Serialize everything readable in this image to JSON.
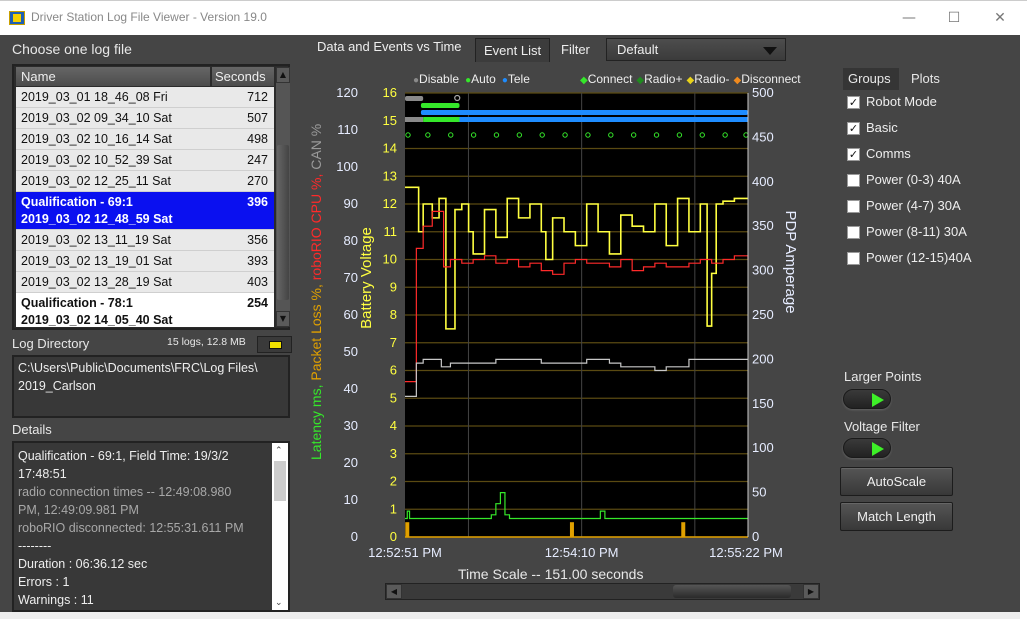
{
  "window": {
    "title": "Driver Station Log File Viewer - Version 19.0",
    "controls": [
      "minimize",
      "maximize",
      "close"
    ]
  },
  "file_list": {
    "label": "Choose one log file",
    "columns": [
      "Name",
      "Seconds"
    ],
    "rows": [
      {
        "name": "2019_03_01 18_46_08 Fri",
        "seconds": "712"
      },
      {
        "name": "2019_03_02 09_34_10 Sat",
        "seconds": "507"
      },
      {
        "name": "2019_03_02 10_16_14 Sat",
        "seconds": "498"
      },
      {
        "name": "2019_03_02 10_52_39 Sat",
        "seconds": "247"
      },
      {
        "name": "2019_03_02 12_25_11 Sat",
        "seconds": "270"
      },
      {
        "name": "Qualification - 69:1",
        "name2": "2019_03_02 12_48_59 Sat",
        "seconds": "396",
        "selected": true
      },
      {
        "name": "2019_03_02 13_11_19 Sat",
        "seconds": "356"
      },
      {
        "name": "2019_03_02 13_19_01 Sat",
        "seconds": "393"
      },
      {
        "name": "2019_03_02 13_28_19 Sat",
        "seconds": "403"
      },
      {
        "name": "Qualification - 78:1",
        "name2": "2019_03_02 14_05_40 Sat",
        "seconds": "254"
      }
    ]
  },
  "log_directory": {
    "label": "Log Directory",
    "summary": "15 logs, 12.8 MB",
    "path_line1": "C:\\Users\\Public\\Documents\\FRC\\Log Files\\",
    "path_line2": "2019_Carlson"
  },
  "details": {
    "label": "Details",
    "lines": [
      {
        "text": " Qualification - 69:1, Field Time: 19/3/2",
        "dim": false
      },
      {
        "text": "17:48:51",
        "dim": false
      },
      {
        "text": "radio connection times --  12:49:08.980",
        "dim": true
      },
      {
        "text": "PM,   12:49:09.981 PM",
        "dim": true
      },
      {
        "text": "roboRIO disconnected:  12:55:31.611 PM",
        "dim": true
      },
      {
        "text": "--------",
        "dim": false
      },
      {
        "text": "Duration : 06:36.12 sec",
        "dim": false
      },
      {
        "text": "Errors : 1",
        "dim": false
      },
      {
        "text": "Warnings : 11",
        "dim": false
      }
    ]
  },
  "tabs": {
    "active": "Data and Events vs Time",
    "event_list": "Event List",
    "filter_label": "Filter",
    "filter_value": "Default"
  },
  "legend": {
    "modes": [
      {
        "label": "Disable",
        "color": "#8a8a8a"
      },
      {
        "label": "Auto",
        "color": "#35e82a"
      },
      {
        "label": "Tele",
        "color": "#1e8cff"
      }
    ],
    "events": [
      {
        "label": "Connect",
        "color": "#35e82a"
      },
      {
        "label": "Radio+",
        "color": "#1f8a1f"
      },
      {
        "label": "Radio-",
        "color": "#e8d21a"
      },
      {
        "label": "Disconnect",
        "color": "#f08a1e"
      }
    ]
  },
  "side_panel": {
    "tabs": [
      "Groups",
      "Plots"
    ],
    "groups": [
      {
        "label": "Robot Mode",
        "checked": true
      },
      {
        "label": "Basic",
        "checked": true
      },
      {
        "label": "Comms",
        "checked": true
      },
      {
        "label": "Power (0-3) 40A",
        "checked": false
      },
      {
        "label": "Power (4-7) 30A",
        "checked": false
      },
      {
        "label": "Power (8-11) 30A",
        "checked": false
      },
      {
        "label": "Power (12-15)40A",
        "checked": false
      }
    ],
    "larger_points_label": "Larger Points",
    "larger_points_on": true,
    "voltage_filter_label": "Voltage Filter",
    "voltage_filter_on": true,
    "autoscale_label": "AutoScale",
    "match_length_label": "Match Length"
  },
  "time_scale": {
    "label": "Time Scale -- 151.00 seconds",
    "scroll_position": 0.78
  },
  "chart_data": {
    "type": "line",
    "title": "",
    "xlabel": "Time",
    "x_ticks": [
      "12:52:51 PM",
      "12:54:10 PM",
      "12:55:22 PM"
    ],
    "x_range_seconds": 151,
    "axes": {
      "left_outer": {
        "label_parts": [
          {
            "text": "Latency ms, ",
            "color": "#35e82a"
          },
          {
            "text": "Packet Loss %, ",
            "color": "#e0a000"
          },
          {
            "text": "roboRIO CPU %, ",
            "color": "#ff2a2a"
          },
          {
            "text": "CAN %",
            "color": "#9a9a9a"
          }
        ],
        "range": [
          0,
          120
        ],
        "ticks": [
          0,
          10,
          20,
          30,
          40,
          50,
          60,
          70,
          80,
          90,
          100,
          110,
          120
        ]
      },
      "left_inner": {
        "label": "Battery Voltage",
        "color": "#ffff40",
        "range": [
          0,
          16
        ],
        "ticks": [
          0,
          1,
          2,
          3,
          4,
          5,
          6,
          7,
          8,
          9,
          10,
          11,
          12,
          13,
          14,
          15,
          16
        ]
      },
      "right": {
        "label": "PDP Amperage",
        "color": "#dfe8ff",
        "range": [
          0,
          500
        ],
        "ticks": [
          0,
          50,
          100,
          150,
          200,
          250,
          300,
          350,
          400,
          450,
          500
        ]
      }
    },
    "grid": true,
    "legend_position": "top",
    "series": [
      {
        "name": "Battery Voltage",
        "axis": "left_inner",
        "color": "#ffff40",
        "x": [
          0,
          5,
          6,
          8,
          12,
          15,
          18,
          22,
          25,
          28,
          30,
          35,
          40,
          45,
          50,
          55,
          60,
          62,
          65,
          70,
          75,
          80,
          85,
          90,
          95,
          100,
          105,
          110,
          115,
          120,
          125,
          130,
          133,
          135,
          137,
          140,
          145,
          151
        ],
        "y": [
          12.6,
          12.6,
          11.0,
          12.0,
          11.5,
          12.2,
          7.5,
          11.8,
          12.0,
          11.0,
          10.2,
          11.8,
          10.8,
          12.2,
          11.5,
          12.0,
          11.0,
          10.0,
          11.5,
          11.0,
          10.5,
          12.0,
          11.0,
          10.2,
          11.6,
          11.2,
          11.0,
          12.0,
          10.5,
          12.2,
          11.0,
          12.0,
          7.6,
          9.5,
          12.0,
          12.1,
          12.2,
          12.2
        ]
      },
      {
        "name": "roboRIO CPU %",
        "axis": "left_outer",
        "color": "#ff2a2a",
        "x": [
          0,
          4,
          5,
          8,
          12,
          15,
          17,
          20,
          25,
          30,
          35,
          40,
          45,
          50,
          55,
          60,
          65,
          70,
          75,
          80,
          85,
          90,
          95,
          100,
          105,
          110,
          115,
          120,
          125,
          130,
          135,
          140,
          145,
          151
        ],
        "y": [
          42,
          42,
          78,
          84,
          88,
          88,
          73,
          75,
          74,
          75,
          76,
          74,
          75,
          73,
          74,
          72,
          71,
          74,
          75,
          74,
          74,
          73,
          75,
          72,
          73,
          74,
          73,
          73,
          74,
          75,
          74,
          75,
          76,
          75
        ]
      },
      {
        "name": "CAN %",
        "axis": "left_outer",
        "color": "#c8c8c8",
        "x": [
          0,
          4,
          5,
          8,
          15,
          16,
          20,
          30,
          40,
          50,
          60,
          70,
          80,
          90,
          95,
          100,
          105,
          110,
          115,
          120,
          125,
          130,
          135,
          140,
          145,
          151
        ],
        "y": [
          38,
          38,
          47,
          48,
          48,
          46,
          47,
          47,
          48,
          48,
          47,
          47,
          48,
          47,
          46,
          46,
          46,
          45,
          46,
          46,
          48,
          48,
          48,
          48,
          48,
          48
        ]
      },
      {
        "name": "Latency ms",
        "axis": "left_outer",
        "color": "#35e82a",
        "x": [
          0,
          1,
          2,
          5,
          10,
          15,
          20,
          25,
          30,
          35,
          38,
          40,
          42,
          44,
          46,
          48,
          50,
          55,
          60,
          65,
          70,
          75,
          80,
          85,
          86,
          88,
          90,
          95,
          100,
          110,
          120,
          130,
          140,
          145,
          151
        ],
        "y": [
          5,
          7,
          5,
          5,
          5,
          5,
          5,
          5,
          5,
          5,
          6,
          9,
          12,
          6,
          5,
          5,
          5,
          5,
          5,
          5,
          5,
          5,
          5,
          5,
          7,
          5,
          5,
          5,
          5,
          5,
          5,
          5,
          5,
          5,
          5
        ]
      },
      {
        "name": "Packet Loss %",
        "axis": "left_outer",
        "color": "#e0a000",
        "type": "bar",
        "x": [
          1,
          73.5,
          122.5
        ],
        "y": [
          4,
          4,
          4
        ]
      }
    ],
    "robot_mode_bands": [
      {
        "mode": "Disable",
        "from": 0,
        "to": 8
      },
      {
        "mode": "Auto",
        "from": 8,
        "to": 24
      },
      {
        "mode": "Tele",
        "from": 24,
        "to": 151
      }
    ],
    "connect_event_markers": 16
  }
}
